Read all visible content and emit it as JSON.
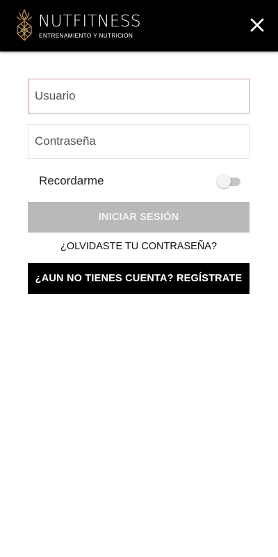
{
  "header": {
    "brand_name": "NUTFITNESS",
    "tagline": "ENTRENAMIENTO Y NUTRICIÓN",
    "logo_icon": "pineapple-logo-icon",
    "close_icon": "close-icon",
    "background": "#000000",
    "logo_color": "#c89b4a"
  },
  "form": {
    "username": {
      "placeholder": "Usuario",
      "value": "",
      "border_color": "#e8888a"
    },
    "password": {
      "placeholder": "Contraseña",
      "value": ""
    },
    "remember": {
      "label": "Recordarme",
      "enabled": false
    },
    "login_button": {
      "label": "INICIAR SESIÓN",
      "background": "#b9b9b9"
    },
    "forgot_link": "¿OLVIDASTE TU CONTRASEÑA?",
    "register_button": {
      "label": "¿AUN NO TIENES CUENTA? REGÍSTRATE",
      "background": "#000000"
    }
  }
}
